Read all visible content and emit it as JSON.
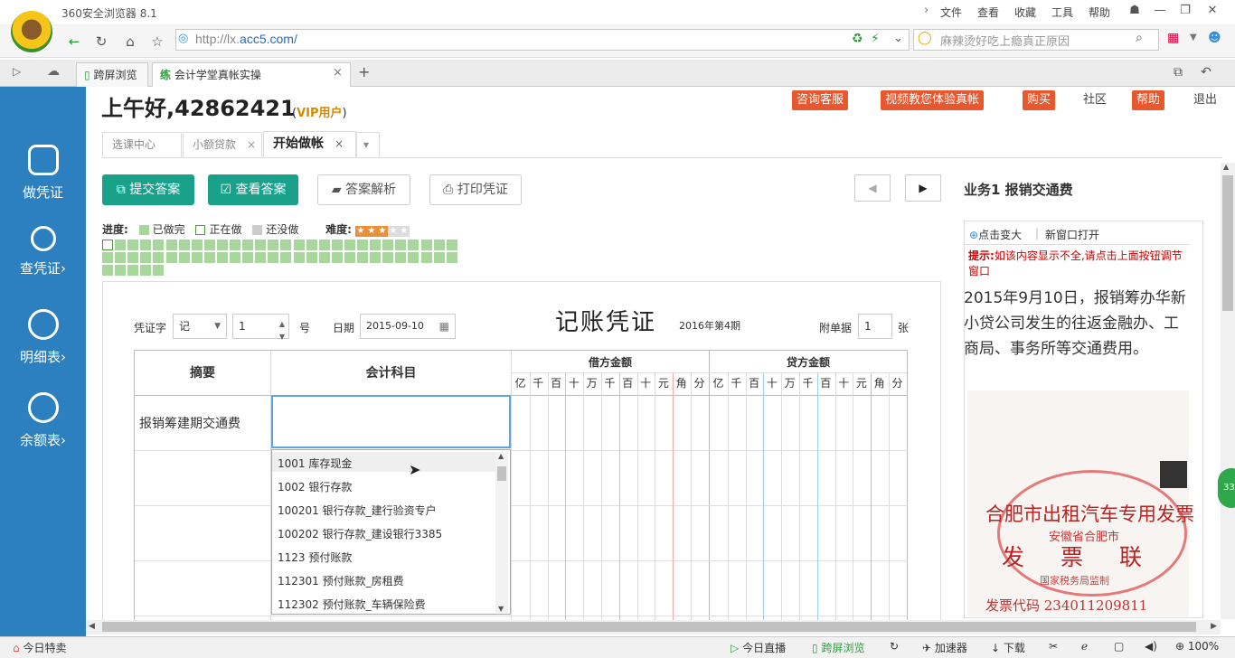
{
  "browser": {
    "title": "360安全浏览器 8.1",
    "menu": [
      "文件",
      "查看",
      "收藏",
      "工具",
      "帮助"
    ],
    "url_prefix": "http://lx.",
    "url_host": "acc5.com/",
    "search_placeholder": "麻辣烫好吃上瘾真正原因",
    "tabs": [
      {
        "label": "跨屏浏览"
      },
      {
        "label": "会计学堂真帐实操",
        "icon_text": "练",
        "close": "×"
      }
    ],
    "new_tab": "+"
  },
  "sidebar": {
    "items": [
      {
        "label": "做凭证"
      },
      {
        "label": "查凭证",
        "arrow": "›"
      },
      {
        "label": "明细表",
        "arrow": "›"
      },
      {
        "label": "余额表",
        "arrow": "›"
      }
    ]
  },
  "header": {
    "greeting": "上午好,42862421",
    "vip_open": "(",
    "vip": "VIP用户",
    "vip_close": ")",
    "links": [
      "咨询客服",
      "视频教您体验真帐",
      "购买",
      "社区",
      "帮助",
      "退出"
    ]
  },
  "content_tabs": [
    {
      "label": "选课中心"
    },
    {
      "label": "小额贷款",
      "close": "×"
    },
    {
      "label": "开始做帐",
      "close": "×"
    }
  ],
  "actions": {
    "submit": "提交答案",
    "view": "查看答案",
    "analysis": "答案解析",
    "print": "打印凭证",
    "prev": "◀",
    "next": "▶"
  },
  "task": {
    "title": "业务1  报销交通费"
  },
  "progress": {
    "label": "进度:",
    "done": "已做完",
    "doing": "正在做",
    "todo": "还没做",
    "difficulty_label": "难度:",
    "difficulty_stars": 3,
    "difficulty_max": 5,
    "total_cells": 61,
    "current_index": 0
  },
  "voucher": {
    "title": "记账凭证",
    "period": "2016年第4期",
    "word_label": "凭证字",
    "word_value": "记",
    "number_value": "1",
    "number_label": "号",
    "date_label": "日期",
    "date_value": "2015-09-10",
    "attach_label": "附单据",
    "attach_value": "1",
    "attach_unit": "张",
    "col_summary": "摘要",
    "col_subject": "会计科目",
    "col_debit": "借方金额",
    "col_credit": "贷方金额",
    "digits": [
      "亿",
      "千",
      "百",
      "十",
      "万",
      "千",
      "百",
      "十",
      "元",
      "角",
      "分"
    ],
    "summary1": "报销筹建期交通费"
  },
  "dropdown": {
    "items": [
      "1001  库存现金",
      "1002  银行存款",
      "100201  银行存款_建行验资专户",
      "100202  银行存款_建设银行3385",
      "1123  预付账款",
      "112301  预付账款_房租费",
      "112302  预付账款_车辆保险费"
    ]
  },
  "right_panel": {
    "zoom": "点击变大",
    "new_window": "新窗口打开",
    "hint_label": "提示:",
    "hint": "如该内容显示不全,请点击上面按钮调节窗口",
    "description": "2015年9月10日，报销筹办华新小贷公司发生的往返金融办、工商局、事务所等交通费用。",
    "receipt_title": "合肥市出租汽车专用发票",
    "receipt_sub": "安徽省合肥市",
    "receipt_big": "发票联",
    "receipt_bureau": "国家税务局监制",
    "receipt_code": "发票代码 234011209811"
  },
  "statusbar": {
    "left": "今日特卖",
    "live": "今日直播",
    "cross": "跨屏浏览",
    "accel": "加速器",
    "download": "下载",
    "zoom": "100%"
  },
  "bubble": "33"
}
